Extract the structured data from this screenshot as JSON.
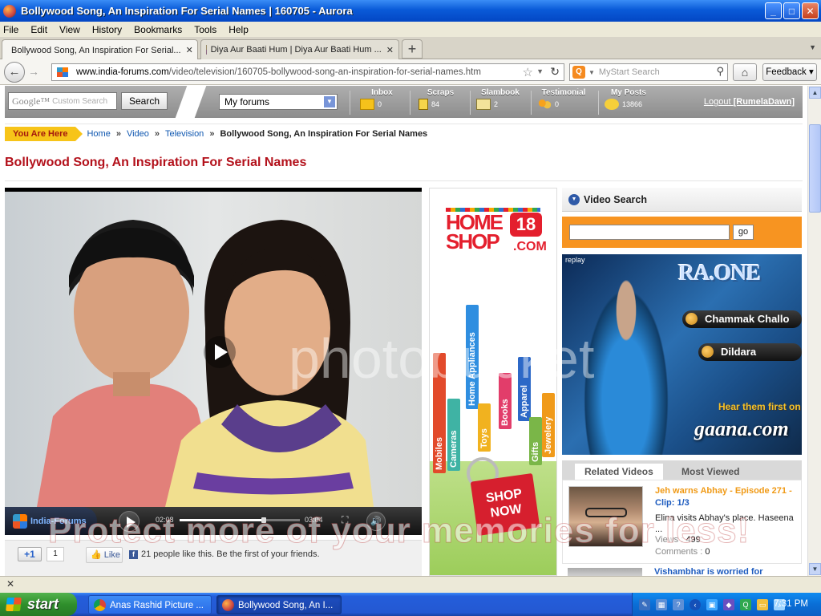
{
  "window": {
    "title": "Bollywood Song, An Inspiration For Serial Names | 160705 - Aurora",
    "minimize": "_",
    "maximize": "□",
    "close": "✕"
  },
  "menu": [
    "File",
    "Edit",
    "View",
    "History",
    "Bookmarks",
    "Tools",
    "Help"
  ],
  "tabs": [
    {
      "label": "Bollywood Song, An Inspiration For Serial...",
      "active": true
    },
    {
      "label": "Diya Aur Baati Hum | Diya Aur Baati Hum ...",
      "active": false
    }
  ],
  "nav": {
    "url_domain": "www.india-forums.com",
    "url_path": "/video/television/160705-bollywood-song-an-inspiration-for-serial-names.htm",
    "search_placeholder": "MyStart Search",
    "feedback": "Feedback"
  },
  "site": {
    "google_placeholder": "Custom Search",
    "google_brand": "Google™",
    "search_btn": "Search",
    "myforums": "My forums",
    "stats": [
      {
        "label": "Inbox",
        "value": "0",
        "icon": "envelope-icon"
      },
      {
        "label": "Scraps",
        "value": "84",
        "icon": "scrap-note-icon"
      },
      {
        "label": "Slambook",
        "value": "2",
        "icon": "slambook-icon"
      },
      {
        "label": "Testimonial",
        "value": "0",
        "icon": "people-icon"
      },
      {
        "label": "My Posts",
        "value": "13866",
        "icon": "speech-bubble-icon"
      }
    ],
    "logout": "Logout",
    "username": "[RumelaDawn]"
  },
  "breadcrumb": {
    "you_are_here": "You Are Here",
    "items": [
      "Home",
      "Video",
      "Television"
    ],
    "current": "Bollywood Song, An Inspiration For Serial Names"
  },
  "page_title": "Bollywood Song, An Inspiration For Serial Names",
  "player": {
    "brand": "India-Forums",
    "current_time": "02:08",
    "total_time": "03:04",
    "progress": 0.7
  },
  "social": {
    "gplus": "+1",
    "gplus_count": "1",
    "like": "Like",
    "fb_text": "21 people like this. Be the first of your friends."
  },
  "ad_homeshop": {
    "brand_line1": "HOME",
    "brand_line2": "SHOP",
    "brand_num": "18",
    "brand_com": ".COM",
    "bags": [
      "Mobiles",
      "Home Appliances",
      "Cameras",
      "Toys",
      "Books",
      "Apparel",
      "Gifts",
      "Jewelery"
    ],
    "cta_line1": "SHOP",
    "cta_line2": "NOW"
  },
  "video_search": {
    "header": "Video Search",
    "go": "go"
  },
  "ad_raone": {
    "replay": "replay",
    "title": "RA.ONE",
    "songs": [
      "Chammak Challo",
      "Dildara"
    ],
    "hear": "Hear them first on",
    "gaana": "gaana.com"
  },
  "related": {
    "tabs": [
      "Related Videos",
      "Most Viewed"
    ],
    "item": {
      "title": "Jeh warns Abhay - Episode 271 -",
      "clip": "Clip: 1/3",
      "desc": "Elina visits Abhay's place. Haseena ...",
      "views_label": "Views :",
      "views": "499",
      "comments_label": "Comments :",
      "comments": "0"
    },
    "next_title": "Vishambhar is worried for"
  },
  "watermark": {
    "text": "Protect more of your memories for less!",
    "logo": "photobucket"
  },
  "taskbar": {
    "start": "start",
    "tasks": [
      "Anas Rashid Picture ...",
      "Bollywood Song, An I..."
    ],
    "clock": "7:31 PM"
  }
}
